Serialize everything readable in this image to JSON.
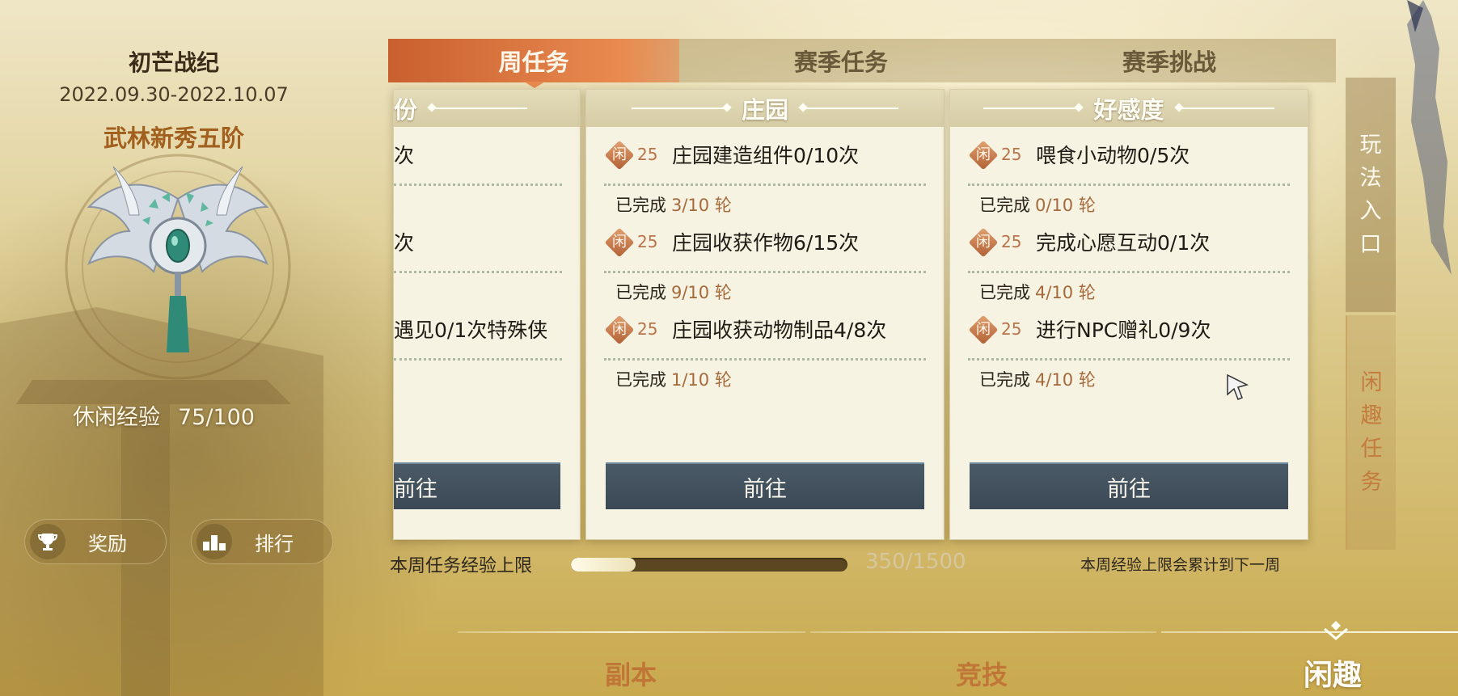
{
  "season": {
    "title": "初芒战纪",
    "date_range": "2022.09.30-2022.10.07",
    "rank": "武林新秀五阶",
    "emblem_icon": "silver-wing-badge-icon"
  },
  "leisure_exp": {
    "label": "休闲经验",
    "value": "75/100"
  },
  "left_buttons": [
    {
      "label": "奖励",
      "icon": "trophy-icon"
    },
    {
      "label": "排行",
      "icon": "podium-icon"
    }
  ],
  "tabs": [
    {
      "label": "周任务",
      "active": true
    },
    {
      "label": "赛季任务",
      "active": false
    },
    {
      "label": "赛季挑战",
      "active": false
    }
  ],
  "cards": [
    {
      "title": "份",
      "tasks": [
        {
          "name": "次",
          "done_label": "",
          "done": ""
        },
        {
          "name": "次",
          "done_label": "",
          "done": ""
        },
        {
          "name": "遇见0/1次特殊侠",
          "done_label": "",
          "done": ""
        }
      ],
      "button": "前往"
    },
    {
      "title": "庄园",
      "tasks": [
        {
          "badge": "闲",
          "points": "25",
          "name": "庄园建造组件0/10次",
          "done_label": "已完成",
          "done": "3/10 轮"
        },
        {
          "badge": "闲",
          "points": "25",
          "name": "庄园收获作物6/15次",
          "done_label": "已完成",
          "done": "9/10 轮"
        },
        {
          "badge": "闲",
          "points": "25",
          "name": "庄园收获动物制品4/8次",
          "done_label": "已完成",
          "done": "1/10 轮"
        }
      ],
      "button": "前往"
    },
    {
      "title": "好感度",
      "tasks": [
        {
          "badge": "闲",
          "points": "25",
          "name": "喂食小动物0/5次",
          "done_label": "已完成",
          "done": "0/10 轮"
        },
        {
          "badge": "闲",
          "points": "25",
          "name": "完成心愿互动0/1次",
          "done_label": "已完成",
          "done": "4/10 轮"
        },
        {
          "badge": "闲",
          "points": "25",
          "name": "进行NPC赠礼0/9次",
          "done_label": "已完成",
          "done": "4/10 轮"
        }
      ],
      "button": "前往"
    }
  ],
  "weekly_cap": {
    "label": "本周任务经验上限",
    "value": "350/1500",
    "progress": 0.233,
    "note": "本周经验上限会累计到下一周"
  },
  "side_tabs": [
    {
      "label": "玩法入口",
      "active": false
    },
    {
      "label": "闲趣任务",
      "active": true
    }
  ],
  "bottom_nav": [
    {
      "label": "副本",
      "active": false
    },
    {
      "label": "竞技",
      "active": false
    },
    {
      "label": "闲趣",
      "active": true
    }
  ],
  "colors": {
    "accent_tab": "#e07a45",
    "button_dark": "#3e4d59",
    "points_orange": "#b8734a",
    "rank_orange": "#a2601e",
    "progress_track": "#5a4620"
  }
}
